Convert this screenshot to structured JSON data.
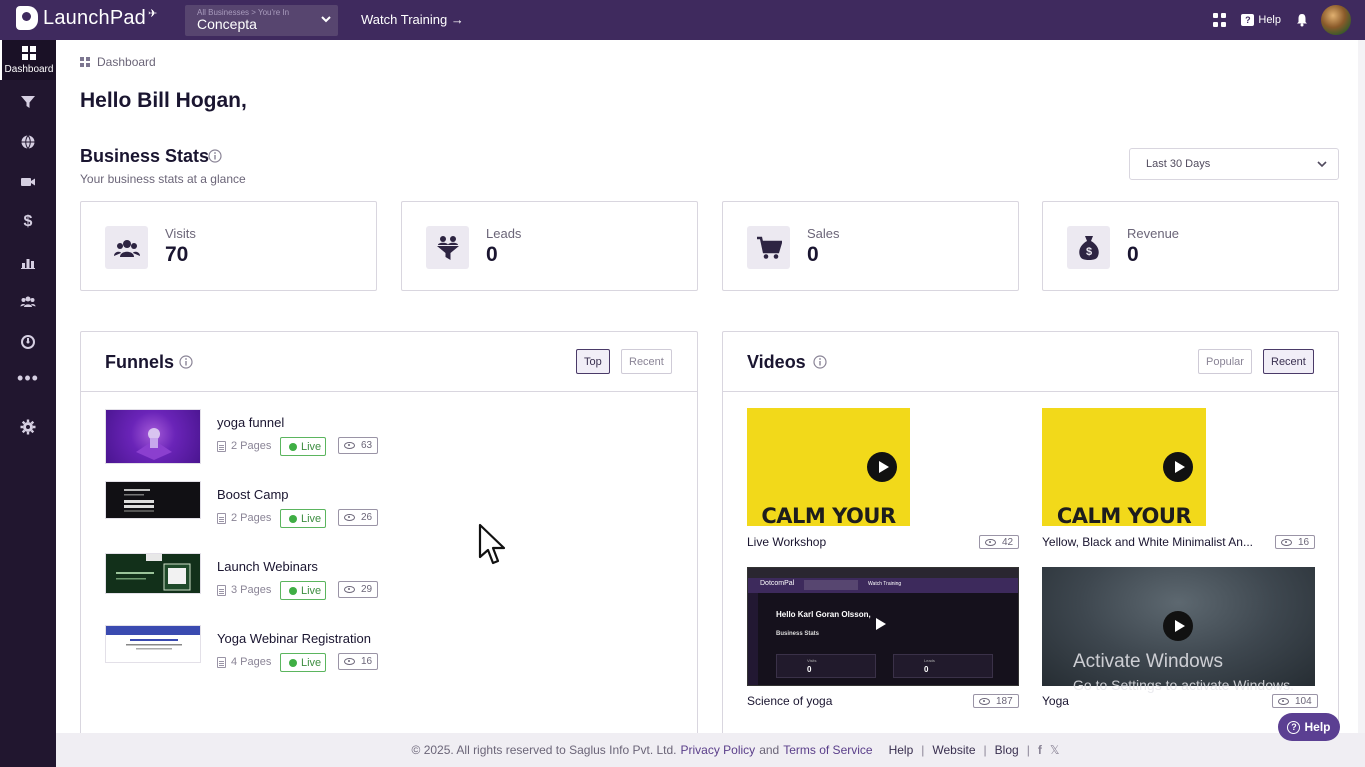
{
  "app": {
    "name": "LaunchPad",
    "business_caption": "All Businesses > You're In",
    "business_name": "Concepta",
    "watch_training": "Watch Training →",
    "help_label": "Help"
  },
  "sidebar": {
    "items": [
      {
        "icon": "dashboard-icon",
        "label": "Dashboard"
      },
      {
        "icon": "funnel-icon"
      },
      {
        "icon": "globe-icon"
      },
      {
        "icon": "video-camera-icon"
      },
      {
        "icon": "dollar-icon"
      },
      {
        "icon": "chart-icon"
      },
      {
        "icon": "users-icon"
      },
      {
        "icon": "gauge-icon"
      },
      {
        "icon": "more-icon"
      },
      {
        "icon": "gear-icon"
      }
    ]
  },
  "breadcrumb": "Dashboard",
  "greeting": "Hello Bill Hogan,",
  "business_stats": {
    "title": "Business Stats",
    "subtitle": "Your business stats at a glance",
    "range": "Last 30 Days",
    "cards": [
      {
        "label": "Visits",
        "value": "70",
        "icon": "users-icon"
      },
      {
        "label": "Leads",
        "value": "0",
        "icon": "funnel-icon"
      },
      {
        "label": "Sales",
        "value": "0",
        "icon": "cart-icon"
      },
      {
        "label": "Revenue",
        "value": "0",
        "icon": "money-bag-icon"
      }
    ]
  },
  "funnels": {
    "title": "Funnels",
    "tabs": [
      "Top",
      "Recent"
    ],
    "active_tab": "Top",
    "items": [
      {
        "name": "yoga funnel",
        "pages": "2 Pages",
        "status": "Live",
        "views": "63"
      },
      {
        "name": "Boost Camp",
        "pages": "2 Pages",
        "status": "Live",
        "views": "26"
      },
      {
        "name": "Launch Webinars",
        "pages": "3 Pages",
        "status": "Live",
        "views": "29"
      },
      {
        "name": "Yoga Webinar Registration",
        "pages": "4 Pages",
        "status": "Live",
        "views": "16"
      }
    ]
  },
  "videos": {
    "title": "Videos",
    "tabs": [
      "Popular",
      "Recent"
    ],
    "active_tab": "Recent",
    "thumb_text": "CALM YOUR",
    "items": [
      {
        "title": "Live Workshop",
        "views": "42"
      },
      {
        "title": "Yellow, Black and White Minimalist An...",
        "views": "16"
      },
      {
        "title": "Science of yoga",
        "views": "187"
      },
      {
        "title": "Yoga",
        "views": "104"
      }
    ],
    "inner_screenshot": {
      "logo": "DotcomPal",
      "greeting": "Hello Karl Goran Olsson,",
      "stats_title": "Business Stats",
      "watch": "Watch Training",
      "visits": "Visits",
      "visits_value": "0",
      "leads": "Leads",
      "leads_value": "0"
    }
  },
  "footer": {
    "copyright": "© 2025. All rights reserved to Saglus Info Pvt. Ltd.",
    "privacy": "Privacy Policy",
    "and": "and",
    "terms": "Terms of Service",
    "help": "Help",
    "website": "Website",
    "blog": "Blog"
  },
  "help_button": "Help",
  "watermark": {
    "line1": "Activate Windows",
    "line2": "Go to Settings to activate Windows."
  },
  "colors": {
    "topbar": "#3f2a5e",
    "sidebar": "#21162f",
    "live_green": "#3fae44",
    "accent": "#5b3f92",
    "video_yellow": "#f2d91a"
  }
}
